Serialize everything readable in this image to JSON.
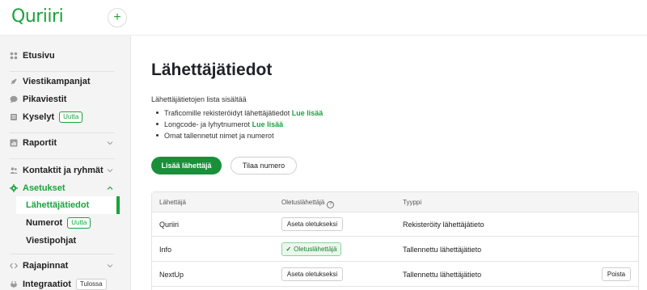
{
  "header": {
    "logo": "Quriiri",
    "add_label": "+"
  },
  "sidebar": {
    "items": [
      {
        "label": "Etusivu",
        "icon": "dashboard-icon"
      },
      {
        "label": "Viestikampanjat",
        "icon": "rocket-icon"
      },
      {
        "label": "Pikaviestit",
        "icon": "chat-bubble-icon"
      },
      {
        "label": "Kyselyt",
        "icon": "survey-icon",
        "badge": "Uutta"
      },
      {
        "label": "Raportit",
        "icon": "chart-icon"
      },
      {
        "label": "Kontaktit ja ryhmät",
        "icon": "contacts-icon"
      },
      {
        "label": "Asetukset",
        "icon": "gear-icon"
      },
      {
        "label": "Rajapinnat",
        "icon": "code-icon"
      },
      {
        "label": "Integraatiot",
        "icon": "integration-icon",
        "badge": "Tulossa"
      }
    ],
    "settings_children": [
      {
        "label": "Lähettäjätiedot"
      },
      {
        "label": "Numerot",
        "badge": "Uutta"
      },
      {
        "label": "Viestipohjat"
      }
    ],
    "accent": "#1aa33b"
  },
  "main": {
    "title": "Lähettäjätiedot",
    "intro": "Lähettäjätietojen lista sisältää",
    "bullets": [
      {
        "text": "Traficomille rekisteröidyt lähettäjätiedot",
        "link": "Lue lisää"
      },
      {
        "text": "Longcode- ja lyhytnumerot",
        "link": "Lue lisää"
      },
      {
        "text": "Omat tallennetut nimet ja numerot",
        "link": ""
      }
    ],
    "add_sender_label": "Lisää lähettäjä",
    "order_number_label": "Tilaa numero"
  },
  "table": {
    "columns": [
      "Lähettäjä",
      "Oletuslähettäjä",
      "Tyyppi"
    ],
    "rows": [
      {
        "sender": "Quriiri",
        "default_action": "Aseta oletukseksi",
        "is_default": false,
        "type": "Rekisteröity lähettäjätieto",
        "remove": ""
      },
      {
        "sender": "Info",
        "default_action": "Oletuslähettäjä",
        "is_default": true,
        "type": "Tallennettu lähettäjätieto",
        "remove": ""
      },
      {
        "sender": "NextUp",
        "default_action": "Aseta oletukseksi",
        "is_default": false,
        "type": "Tallennettu lähettäjätieto",
        "remove": "Poista"
      }
    ]
  }
}
